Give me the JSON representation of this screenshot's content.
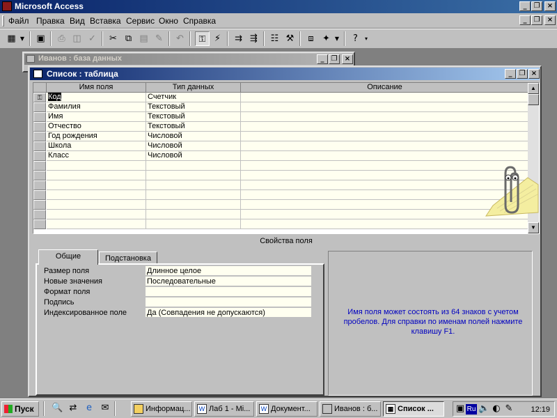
{
  "app": {
    "title": "Microsoft Access"
  },
  "window_controls": {
    "minimize": "_",
    "restore": "❐",
    "close": "×"
  },
  "menu": {
    "items": [
      "Файл",
      "Правка",
      "Вид",
      "Вставка",
      "Сервис",
      "Окно",
      "Справка"
    ]
  },
  "db_window": {
    "title": "Иванов : база данных"
  },
  "table_window": {
    "title": "Список : таблица",
    "columns": [
      "Имя поля",
      "Тип данных",
      "Описание"
    ],
    "rows": [
      {
        "name": "Код",
        "type": "Счетчик",
        "desc": ""
      },
      {
        "name": "Фамилия",
        "type": "Текстовый",
        "desc": ""
      },
      {
        "name": "Имя",
        "type": "Текстовый",
        "desc": ""
      },
      {
        "name": "Отчество",
        "type": "Текстовый",
        "desc": ""
      },
      {
        "name": "Год рождения",
        "type": "Числовой",
        "desc": ""
      },
      {
        "name": "Школа",
        "type": "Числовой",
        "desc": ""
      },
      {
        "name": "Класс",
        "type": "Числовой",
        "desc": ""
      }
    ],
    "field_properties_title": "Свойства поля",
    "tabs": [
      "Общие",
      "Подстановка"
    ],
    "properties": [
      {
        "label": "Размер поля",
        "value": "Длинное целое"
      },
      {
        "label": "Новые значения",
        "value": "Последовательные"
      },
      {
        "label": "Формат поля",
        "value": ""
      },
      {
        "label": "Подпись",
        "value": ""
      },
      {
        "label": "Индексированное поле",
        "value": "Да (Совпадения не допускаются)"
      }
    ],
    "hint": "Имя поля может состоять из 64 знаков с учетом пробелов.  Для справки по именам полей нажмите клавишу F1."
  },
  "taskbar": {
    "start": "Пуск",
    "tasks": [
      {
        "label": "Информац...",
        "icon": "folder-icon"
      },
      {
        "label": "Лаб 1 - Mi...",
        "icon": "word-icon"
      },
      {
        "label": "Документ...",
        "icon": "word-icon"
      },
      {
        "label": "Иванов : б...",
        "icon": "access-icon"
      },
      {
        "label": "Список ...",
        "icon": "table-icon"
      }
    ],
    "tray_lang": "Ru",
    "clock": "12:19"
  },
  "colors": {
    "active_title": "#0a246a",
    "inactive_title": "#808080",
    "hint_text": "#0000c0",
    "cell_bg": "#fffff0"
  }
}
